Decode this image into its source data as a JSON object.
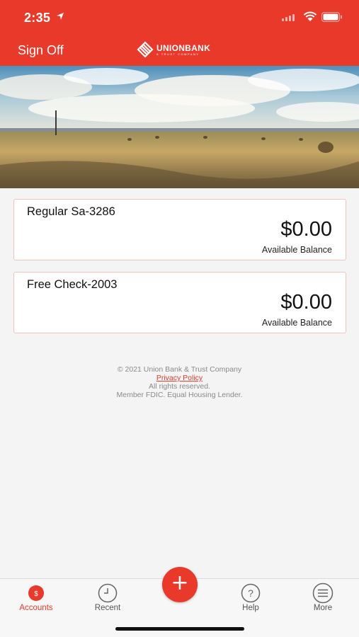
{
  "status_bar": {
    "time": "2:35",
    "icons": [
      "location-arrow-icon",
      "cellular-signal-icon",
      "wifi-icon",
      "battery-icon"
    ]
  },
  "header": {
    "sign_off_label": "Sign Off",
    "logo_name": "UNIONBANK",
    "logo_subtitle": "& TRUST COMPANY",
    "color": "#e8392b"
  },
  "accounts": [
    {
      "name": "Regular Sa-3286",
      "balance": "$0.00",
      "balance_label": "Available Balance"
    },
    {
      "name": "Free Check-2003",
      "balance": "$0.00",
      "balance_label": "Available Balance"
    }
  ],
  "footer": {
    "copyright": "© 2021 Union Bank & Trust Company",
    "privacy_link": "Privacy Policy",
    "rights": "All rights reserved.",
    "member": "Member FDIC. Equal Housing Lender."
  },
  "tab_bar": {
    "tabs": [
      {
        "label": "Accounts",
        "icon": "dollar-circle-icon",
        "active": true
      },
      {
        "label": "Recent",
        "icon": "clock-icon",
        "active": false
      },
      {
        "label": "",
        "icon": "plus-icon",
        "active": false
      },
      {
        "label": "Help",
        "icon": "question-circle-icon",
        "active": false
      },
      {
        "label": "More",
        "icon": "hamburger-menu-icon",
        "active": false
      }
    ],
    "plus_symbol": "+"
  }
}
